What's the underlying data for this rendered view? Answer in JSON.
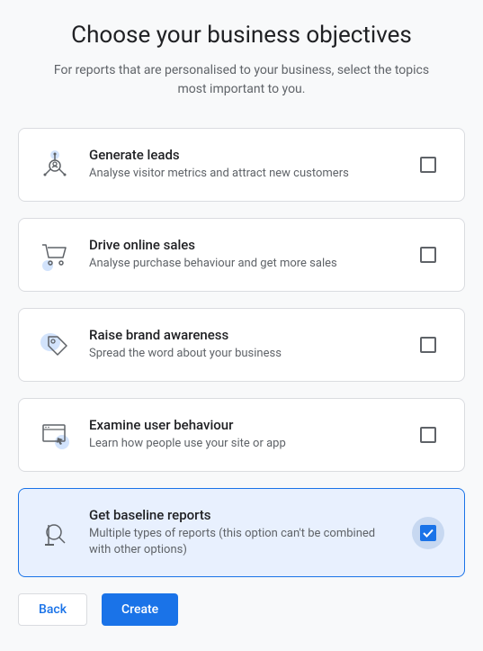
{
  "title": "Choose your business objectives",
  "subtitle": "For reports that are personalised to your business, select the topics most important to you.",
  "objectives": [
    {
      "id": "generate-leads",
      "title": "Generate leads",
      "desc": "Analyse visitor metrics and attract new customers",
      "checked": false
    },
    {
      "id": "drive-online-sales",
      "title": "Drive online sales",
      "desc": "Analyse purchase behaviour and get more sales",
      "checked": false
    },
    {
      "id": "raise-brand-awareness",
      "title": "Raise brand awareness",
      "desc": "Spread the word about your business",
      "checked": false
    },
    {
      "id": "examine-user-behaviour",
      "title": "Examine user behaviour",
      "desc": "Learn how people use your site or app",
      "checked": false
    },
    {
      "id": "get-baseline-reports",
      "title": "Get baseline reports",
      "desc": "Multiple types of reports (this option can't be combined with other options)",
      "checked": true
    }
  ],
  "buttons": {
    "back": "Back",
    "create": "Create"
  }
}
